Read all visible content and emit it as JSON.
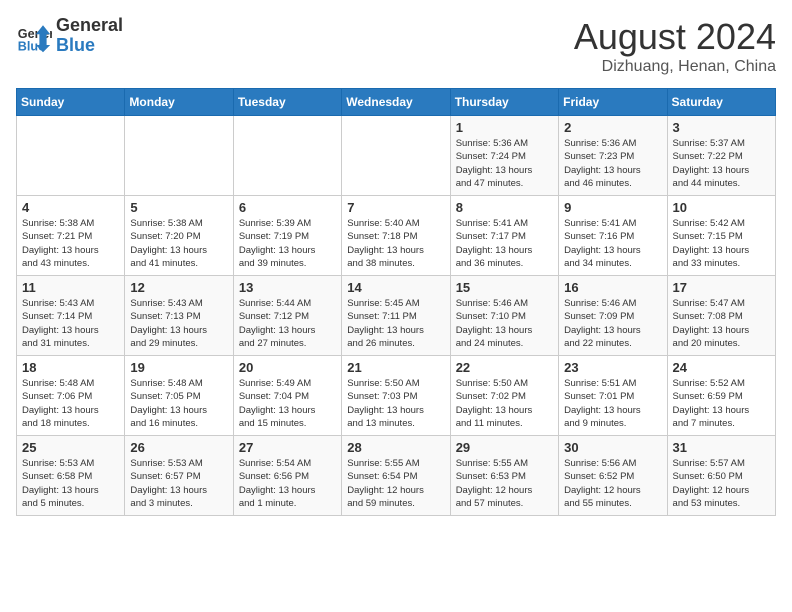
{
  "header": {
    "logo_line1": "General",
    "logo_line2": "Blue",
    "month": "August 2024",
    "location": "Dizhuang, Henan, China"
  },
  "weekdays": [
    "Sunday",
    "Monday",
    "Tuesday",
    "Wednesday",
    "Thursday",
    "Friday",
    "Saturday"
  ],
  "weeks": [
    [
      {
        "day": "",
        "info": ""
      },
      {
        "day": "",
        "info": ""
      },
      {
        "day": "",
        "info": ""
      },
      {
        "day": "",
        "info": ""
      },
      {
        "day": "1",
        "info": "Sunrise: 5:36 AM\nSunset: 7:24 PM\nDaylight: 13 hours\nand 47 minutes."
      },
      {
        "day": "2",
        "info": "Sunrise: 5:36 AM\nSunset: 7:23 PM\nDaylight: 13 hours\nand 46 minutes."
      },
      {
        "day": "3",
        "info": "Sunrise: 5:37 AM\nSunset: 7:22 PM\nDaylight: 13 hours\nand 44 minutes."
      }
    ],
    [
      {
        "day": "4",
        "info": "Sunrise: 5:38 AM\nSunset: 7:21 PM\nDaylight: 13 hours\nand 43 minutes."
      },
      {
        "day": "5",
        "info": "Sunrise: 5:38 AM\nSunset: 7:20 PM\nDaylight: 13 hours\nand 41 minutes."
      },
      {
        "day": "6",
        "info": "Sunrise: 5:39 AM\nSunset: 7:19 PM\nDaylight: 13 hours\nand 39 minutes."
      },
      {
        "day": "7",
        "info": "Sunrise: 5:40 AM\nSunset: 7:18 PM\nDaylight: 13 hours\nand 38 minutes."
      },
      {
        "day": "8",
        "info": "Sunrise: 5:41 AM\nSunset: 7:17 PM\nDaylight: 13 hours\nand 36 minutes."
      },
      {
        "day": "9",
        "info": "Sunrise: 5:41 AM\nSunset: 7:16 PM\nDaylight: 13 hours\nand 34 minutes."
      },
      {
        "day": "10",
        "info": "Sunrise: 5:42 AM\nSunset: 7:15 PM\nDaylight: 13 hours\nand 33 minutes."
      }
    ],
    [
      {
        "day": "11",
        "info": "Sunrise: 5:43 AM\nSunset: 7:14 PM\nDaylight: 13 hours\nand 31 minutes."
      },
      {
        "day": "12",
        "info": "Sunrise: 5:43 AM\nSunset: 7:13 PM\nDaylight: 13 hours\nand 29 minutes."
      },
      {
        "day": "13",
        "info": "Sunrise: 5:44 AM\nSunset: 7:12 PM\nDaylight: 13 hours\nand 27 minutes."
      },
      {
        "day": "14",
        "info": "Sunrise: 5:45 AM\nSunset: 7:11 PM\nDaylight: 13 hours\nand 26 minutes."
      },
      {
        "day": "15",
        "info": "Sunrise: 5:46 AM\nSunset: 7:10 PM\nDaylight: 13 hours\nand 24 minutes."
      },
      {
        "day": "16",
        "info": "Sunrise: 5:46 AM\nSunset: 7:09 PM\nDaylight: 13 hours\nand 22 minutes."
      },
      {
        "day": "17",
        "info": "Sunrise: 5:47 AM\nSunset: 7:08 PM\nDaylight: 13 hours\nand 20 minutes."
      }
    ],
    [
      {
        "day": "18",
        "info": "Sunrise: 5:48 AM\nSunset: 7:06 PM\nDaylight: 13 hours\nand 18 minutes."
      },
      {
        "day": "19",
        "info": "Sunrise: 5:48 AM\nSunset: 7:05 PM\nDaylight: 13 hours\nand 16 minutes."
      },
      {
        "day": "20",
        "info": "Sunrise: 5:49 AM\nSunset: 7:04 PM\nDaylight: 13 hours\nand 15 minutes."
      },
      {
        "day": "21",
        "info": "Sunrise: 5:50 AM\nSunset: 7:03 PM\nDaylight: 13 hours\nand 13 minutes."
      },
      {
        "day": "22",
        "info": "Sunrise: 5:50 AM\nSunset: 7:02 PM\nDaylight: 13 hours\nand 11 minutes."
      },
      {
        "day": "23",
        "info": "Sunrise: 5:51 AM\nSunset: 7:01 PM\nDaylight: 13 hours\nand 9 minutes."
      },
      {
        "day": "24",
        "info": "Sunrise: 5:52 AM\nSunset: 6:59 PM\nDaylight: 13 hours\nand 7 minutes."
      }
    ],
    [
      {
        "day": "25",
        "info": "Sunrise: 5:53 AM\nSunset: 6:58 PM\nDaylight: 13 hours\nand 5 minutes."
      },
      {
        "day": "26",
        "info": "Sunrise: 5:53 AM\nSunset: 6:57 PM\nDaylight: 13 hours\nand 3 minutes."
      },
      {
        "day": "27",
        "info": "Sunrise: 5:54 AM\nSunset: 6:56 PM\nDaylight: 13 hours\nand 1 minute."
      },
      {
        "day": "28",
        "info": "Sunrise: 5:55 AM\nSunset: 6:54 PM\nDaylight: 12 hours\nand 59 minutes."
      },
      {
        "day": "29",
        "info": "Sunrise: 5:55 AM\nSunset: 6:53 PM\nDaylight: 12 hours\nand 57 minutes."
      },
      {
        "day": "30",
        "info": "Sunrise: 5:56 AM\nSunset: 6:52 PM\nDaylight: 12 hours\nand 55 minutes."
      },
      {
        "day": "31",
        "info": "Sunrise: 5:57 AM\nSunset: 6:50 PM\nDaylight: 12 hours\nand 53 minutes."
      }
    ]
  ]
}
